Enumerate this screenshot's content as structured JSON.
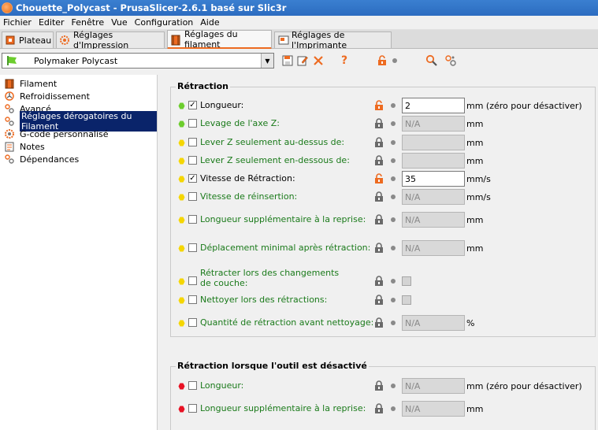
{
  "window": {
    "title": "Chouette_Polycast - PrusaSlicer-2.6.1 basé sur Slic3r"
  },
  "menu": [
    "Fichier",
    "Editer",
    "Fenêtre",
    "Vue",
    "Configuration",
    "Aide"
  ],
  "tabs": [
    {
      "label": "Plateau",
      "icon": "plater-icon",
      "active": false
    },
    {
      "label": "Réglages d'Impression",
      "icon": "cog-icon",
      "active": false
    },
    {
      "label": "Réglages du filament",
      "icon": "spool-icon",
      "active": true
    },
    {
      "label": "Réglages de l'Imprimante",
      "icon": "printer-icon",
      "active": false
    }
  ],
  "preset": {
    "name": "Polymaker Polycast"
  },
  "toolbar": {
    "save": "save-icon",
    "rename": "edit-icon",
    "delete": "delete-icon",
    "help": "?",
    "lock": "unlocked-icon",
    "search": "search-icon",
    "compare": "compare-icon"
  },
  "sidebar": {
    "items": [
      {
        "label": "Filament",
        "icon": "spool-icon",
        "selected": false
      },
      {
        "label": "Refroidissement",
        "icon": "cooling-icon",
        "selected": false
      },
      {
        "label": "Avancé",
        "icon": "wrench-icon",
        "selected": false
      },
      {
        "label": "Réglages dérogatoires du Filament",
        "icon": "wrench-icon",
        "selected": true
      },
      {
        "label": "G-code personnalisé",
        "icon": "cog-icon",
        "selected": false
      },
      {
        "label": "Notes",
        "icon": "note-icon",
        "selected": false
      },
      {
        "label": "Dépendances",
        "icon": "wrench-icon",
        "selected": false
      }
    ]
  },
  "retraction": {
    "title": "Rétraction",
    "rows": [
      {
        "label": "Longueur:",
        "dot": "#6ccd2d",
        "checked": true,
        "unlocked": true,
        "value": "2",
        "kind": "text",
        "unit": "mm (zéro pour désactiver)"
      },
      {
        "label": "Levage de l'axe Z:",
        "dot": "#6ccd2d",
        "checked": false,
        "unlocked": false,
        "value": "N/A",
        "kind": "text",
        "unit": "mm"
      },
      {
        "label": "Lever Z seulement au-dessus de:",
        "dot": "#f5d600",
        "checked": false,
        "unlocked": false,
        "value": "",
        "kind": "text",
        "unit": "mm"
      },
      {
        "label": "Lever Z seulement en-dessous de:",
        "dot": "#f5d600",
        "checked": false,
        "unlocked": false,
        "value": "",
        "kind": "text",
        "unit": "mm"
      },
      {
        "label": "Vitesse de Rétraction:",
        "dot": "#f5d600",
        "checked": true,
        "unlocked": true,
        "value": "35",
        "kind": "text",
        "unit": "mm/s"
      },
      {
        "label": "Vitesse de réinsertion:",
        "dot": "#f5d600",
        "checked": false,
        "unlocked": false,
        "value": "N/A",
        "kind": "text",
        "unit": "mm/s"
      },
      {
        "label": "Longueur supplémentaire à la reprise:",
        "dot": "#f5d600",
        "checked": false,
        "unlocked": false,
        "value": "N/A",
        "kind": "text",
        "unit": "mm"
      },
      {
        "label": "Déplacement minimal après rétraction:",
        "dot": "#f5d600",
        "checked": false,
        "unlocked": false,
        "value": "N/A",
        "kind": "text",
        "unit": "mm"
      },
      {
        "label": "Rétracter lors des changements de couche:",
        "dot": "#f5d600",
        "checked": false,
        "unlocked": false,
        "value": "",
        "kind": "checkbox",
        "unit": ""
      },
      {
        "label": "Nettoyer lors des rétractions:",
        "dot": "#f5d600",
        "checked": false,
        "unlocked": false,
        "value": "",
        "kind": "checkbox",
        "unit": ""
      },
      {
        "label": "Quantité de rétraction avant nettoyage:",
        "dot": "#f5d600",
        "checked": false,
        "unlocked": false,
        "value": "N/A",
        "kind": "text",
        "unit": "%"
      }
    ]
  },
  "retraction_disabled": {
    "title": "Rétraction lorsque l'outil est désactivé",
    "rows": [
      {
        "label": "Longueur:",
        "dot": "#e81123",
        "checked": false,
        "unlocked": false,
        "value": "N/A",
        "kind": "text",
        "unit": "mm (zéro pour désactiver)"
      },
      {
        "label": "Longueur supplémentaire à la reprise:",
        "dot": "#e81123",
        "checked": false,
        "unlocked": false,
        "value": "N/A",
        "kind": "text",
        "unit": "mm"
      }
    ]
  }
}
